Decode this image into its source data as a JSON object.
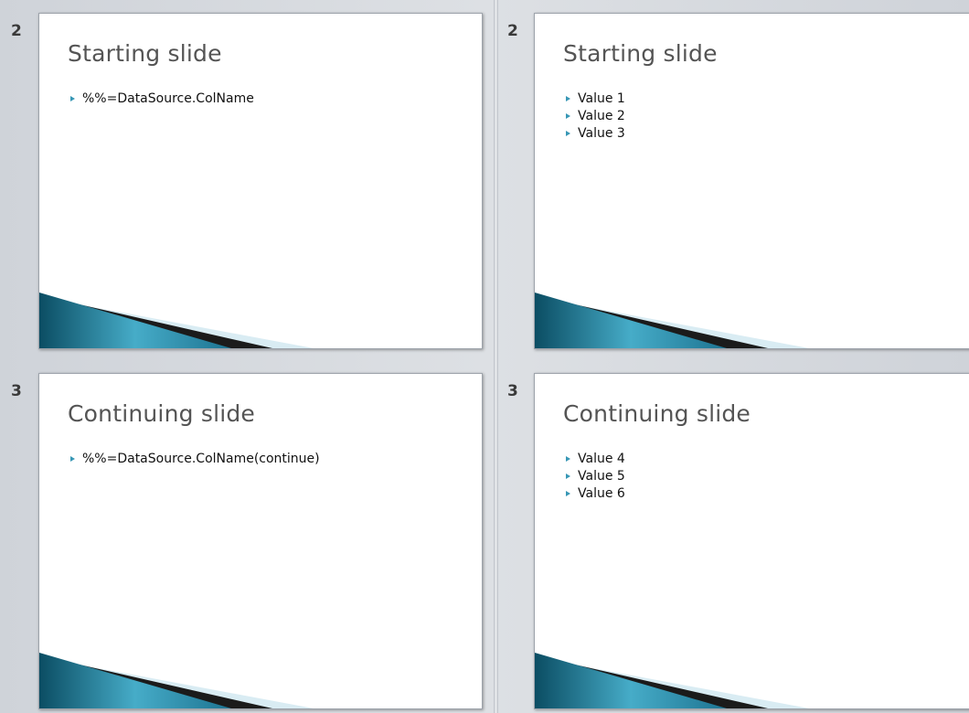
{
  "colors": {
    "accent": "#3797b5",
    "teal_dark": "#0b4d63",
    "title_gray": "#545454"
  },
  "left_column": [
    {
      "slide_number": "2",
      "title": "Starting slide",
      "bullets": [
        "%%=DataSource.ColName"
      ]
    },
    {
      "slide_number": "3",
      "title": "Continuing slide",
      "bullets": [
        "%%=DataSource.ColName(continue)"
      ]
    }
  ],
  "right_column": [
    {
      "slide_number": "2",
      "title": "Starting slide",
      "bullets": [
        "Value 1",
        "Value 2",
        "Value 3"
      ]
    },
    {
      "slide_number": "3",
      "title": "Continuing slide",
      "bullets": [
        "Value 4",
        "Value 5",
        "Value 6"
      ]
    }
  ],
  "icons": {
    "bullet": "triangle-bullet-icon",
    "decoration": "teal-swoosh-decoration"
  }
}
